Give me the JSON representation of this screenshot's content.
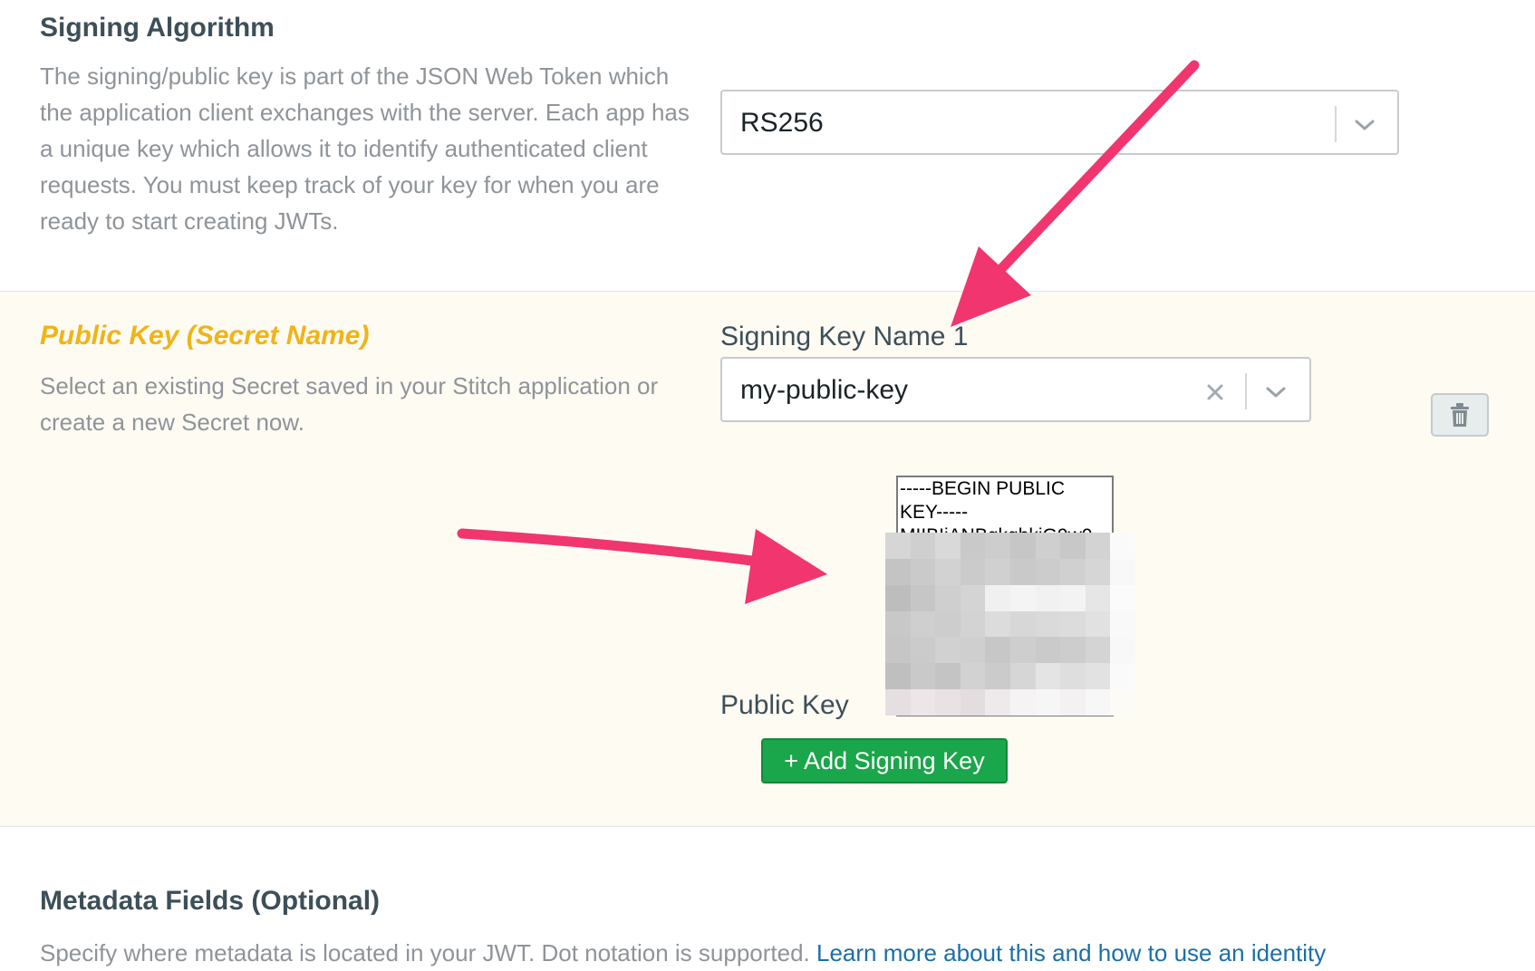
{
  "signing_algorithm": {
    "title": "Signing Algorithm",
    "description": "The signing/public key is part of the JSON Web Token which the application client exchanges with the server. Each app has a unique key which allows it to identify authenticated client requests. You must keep track of your key for when you are ready to start creating JWTs.",
    "description_lines": [
      "The signing/public key is part of the JSON Web Token which",
      "the application client exchanges with the server. Each app has",
      "a unique key which allows it to identify authenticated client",
      "requests. You must keep track of your key for when you are",
      "ready to start creating JWTs."
    ],
    "selected_value": "RS256"
  },
  "public_key": {
    "title": "Public Key (Secret Name)",
    "description_lines": [
      "Select an existing Secret saved in your Stitch application or",
      "create a new Secret now."
    ],
    "signing_key_label": "Signing Key Name 1",
    "signing_key_value": "my-public-key",
    "key_text_lines": [
      "-----BEGIN PUBLIC",
      "KEY-----",
      "MIIBIjANBgkqhkiG9w0"
    ],
    "public_key_label": "Public Key",
    "add_button_label": "+ Add Signing Key"
  },
  "metadata": {
    "title": "Metadata Fields (Optional)",
    "description": "Specify where metadata is located in your JWT. Dot notation is supported.",
    "link_text": "Learn more about this and how to use an identity"
  },
  "colors": {
    "accent_yellow": "#f0b418",
    "link_blue": "#1a6fa8",
    "button_green": "#1aa64a",
    "annotation_arrow": "#f0356f",
    "mid_section_bg": "#fefbf3"
  },
  "icons": {
    "dropdown": "chevron-down-icon",
    "clear": "close-icon",
    "delete": "trash-icon"
  }
}
